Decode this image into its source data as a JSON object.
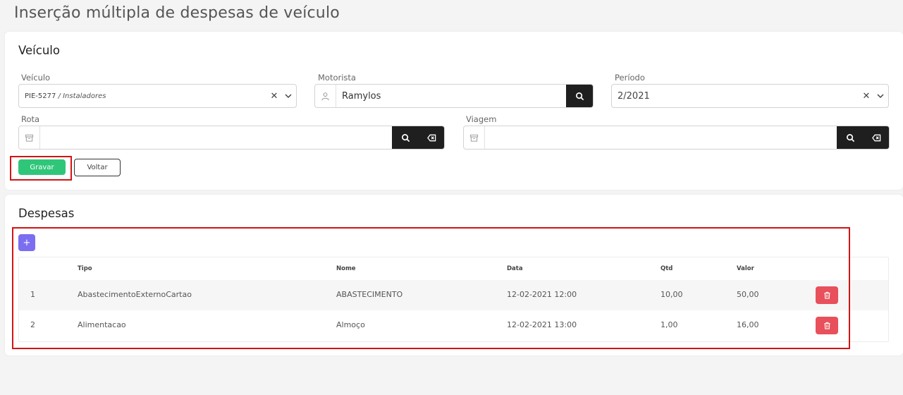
{
  "page": {
    "title": "Inserção múltipla de despesas de veículo"
  },
  "veiculo_section": {
    "title": "Veículo",
    "veiculo": {
      "label": "Veículo",
      "plate": "PIE-5277",
      "separator": " / ",
      "group": "Instaladores",
      "clear_icon": "x-icon",
      "dropdown_icon": "chevron-down-icon"
    },
    "motorista": {
      "label": "Motorista",
      "value": "Ramylos",
      "user_icon": "user-icon",
      "search_icon": "search-icon"
    },
    "periodo": {
      "label": "Período",
      "value": "2/2021",
      "clear_icon": "x-icon",
      "dropdown_icon": "chevron-down-icon"
    },
    "rota": {
      "label": "Rota",
      "value": "",
      "box_icon": "archive-icon",
      "search_icon": "search-icon",
      "clear_icon": "backspace-icon"
    },
    "viagem": {
      "label": "Viagem",
      "value": "",
      "box_icon": "archive-icon",
      "search_icon": "search-icon",
      "clear_icon": "backspace-icon"
    },
    "buttons": {
      "gravar": "Gravar",
      "voltar": "Voltar"
    }
  },
  "despesas_section": {
    "title": "Despesas",
    "add_label": "+",
    "columns": [
      "",
      "Tipo",
      "Nome",
      "Data",
      "Qtd",
      "Valor"
    ],
    "rows": [
      {
        "n": "1",
        "tipo": "AbastecimentoExternoCartao",
        "nome": "ABASTECIMENTO",
        "data": "12-02-2021 12:00",
        "qtd": "10,00",
        "valor": "50,00"
      },
      {
        "n": "2",
        "tipo": "Alimentacao",
        "nome": "Almoço",
        "data": "12-02-2021 13:00",
        "qtd": "1,00",
        "valor": "16,00"
      }
    ]
  },
  "colors": {
    "accent_green": "#30c67a",
    "add_purple": "#7b6ef0",
    "delete_red": "#e8505b",
    "highlight_red": "#d21414",
    "dark_button": "#1f1f1f"
  }
}
